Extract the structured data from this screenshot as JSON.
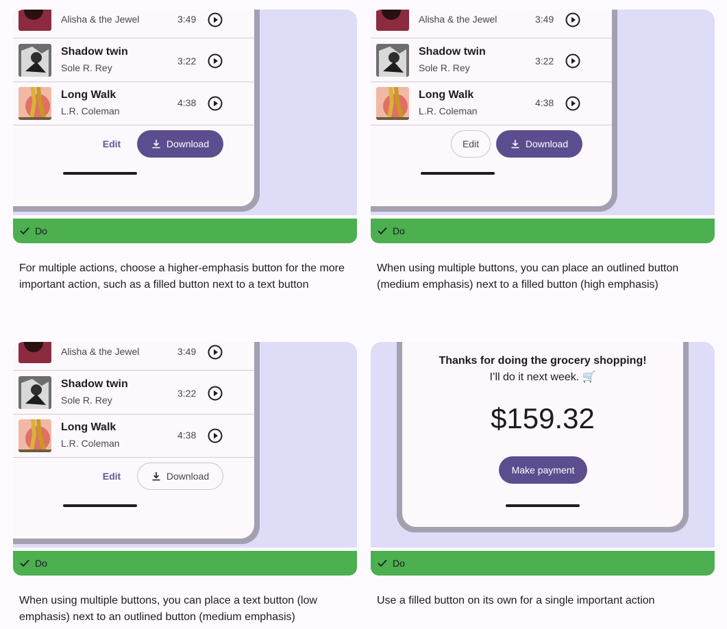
{
  "songs": [
    {
      "title": "",
      "artist": "Alisha & the Jewel",
      "duration": "3:49"
    },
    {
      "title": "Shadow twin",
      "artist": "Sole R. Rey",
      "duration": "3:22"
    },
    {
      "title": "Long Walk",
      "artist": "L.R. Coleman",
      "duration": "4:38"
    }
  ],
  "buttons": {
    "edit": "Edit",
    "download": "Download",
    "make_payment": "Make payment"
  },
  "badge_label": "Do",
  "payment": {
    "message_line1": "Thanks for doing the grocery shopping!",
    "message_line2": "I’ll do it next week. 🛒",
    "amount": "$159.32"
  },
  "captions": {
    "card1": "For multiple actions, choose a higher-emphasis button for the more important action, such as a filled button next to a text button",
    "card2": "When using multiple buttons, you can place an outlined button (medium emphasis) next to a filled button (high emphasis)",
    "card3": "When using multiple buttons, you can place a text button (low emphasis) next to an outlined button (medium emphasis)",
    "card4": "Use a filled button on its own for a single important action"
  },
  "colors": {
    "accent": "#5c4d8f",
    "do_green": "#4caf50",
    "stage_bg": "#dedcf6"
  }
}
